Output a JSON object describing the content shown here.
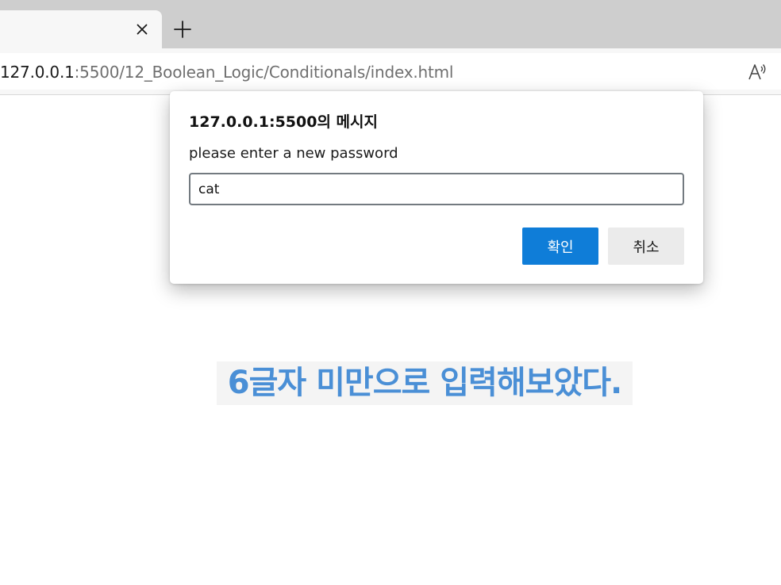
{
  "browser": {
    "tab": {
      "close_label": "×"
    },
    "new_tab_label": "+",
    "address": {
      "host": "127.0.0.1",
      "path": ":5500/12_Boolean_Logic/Conditionals/index.html"
    },
    "icons": {
      "close": "close-icon",
      "new_tab": "plus-icon",
      "read_aloud": "read-aloud-icon"
    }
  },
  "page": {
    "heading": "6글자 미만으로 입력해보았다."
  },
  "dialog": {
    "title": "127.0.0.1:5500의 메시지",
    "message": "please enter a new password",
    "input_value": "cat",
    "ok_label": "확인",
    "cancel_label": "취소"
  },
  "colors": {
    "accent": "#0f7dd8",
    "heading_text": "#4a8fd6",
    "tabstrip": "#cecece"
  }
}
